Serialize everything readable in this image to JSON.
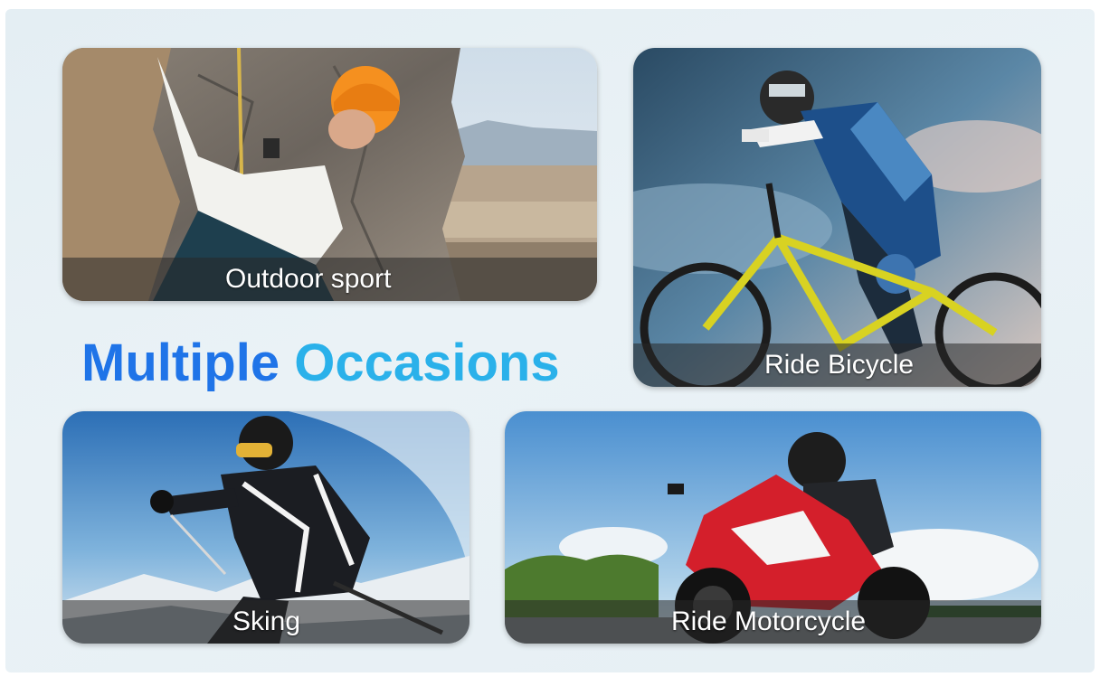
{
  "headline": {
    "word1": "Multiple",
    "word2": "Occasions",
    "color1": "#1f74e8",
    "color2": "#2ab1ea"
  },
  "cards": [
    {
      "caption": "Outdoor sport"
    },
    {
      "caption": "Ride Bicycle"
    },
    {
      "caption": "Sking"
    },
    {
      "caption": "Ride Motorcycle"
    }
  ]
}
